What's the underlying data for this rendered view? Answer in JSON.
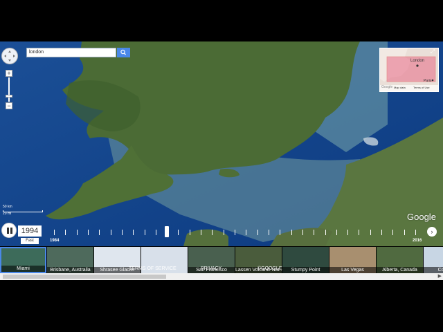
{
  "search": {
    "value": "london"
  },
  "icons": {
    "search": "search-icon",
    "pan": "pan-control-icon",
    "expand": "expand-icon",
    "pause": "pause-icon",
    "next": "chevron-right-icon"
  },
  "zoom": {
    "in_label": "+",
    "out_label": "−"
  },
  "minimap": {
    "city1": "London",
    "city2": "Paris",
    "footer_left": "Map data",
    "footer_right": "Terms of Use",
    "footer_logo": "Google"
  },
  "scale": {
    "km": "50 km",
    "mi": "20 mi"
  },
  "branding": {
    "logo": "Google"
  },
  "timeline": {
    "current_year": "1994",
    "speed_label": "Fast",
    "start_year": "1984",
    "end_year": "2016",
    "position_fraction": 0.3125,
    "next_label": "›"
  },
  "thumbnails": [
    {
      "label": "Miami",
      "color": "#3d6b5a"
    },
    {
      "label": "Brisbane, Australia",
      "color": "#4e6a5c"
    },
    {
      "label": "Shrasee Glacier",
      "color": "#dfe6ee"
    },
    {
      "label": "",
      "color": "#d8e0ea"
    },
    {
      "label": "San Francisco",
      "color": "#49604f"
    },
    {
      "label": "Lassen Volcanic Nat...",
      "color": "#4a5c3c"
    },
    {
      "label": "Stumpy Point",
      "color": "#2f4a3f"
    },
    {
      "label": "Las Vegas",
      "color": "#a88f6f"
    },
    {
      "label": "Alberta, Canada",
      "color": "#506a40"
    },
    {
      "label": "Columbi",
      "color": "#c8d6e4"
    }
  ],
  "overlay": {
    "terms": "TERMS OF SERVICE",
    "privacy": "PRIVACY",
    "google": "©GOOGLE"
  },
  "colors": {
    "sea": "#0f3f86",
    "land": "#4e6e36",
    "selected_border": "#4a88e8"
  }
}
